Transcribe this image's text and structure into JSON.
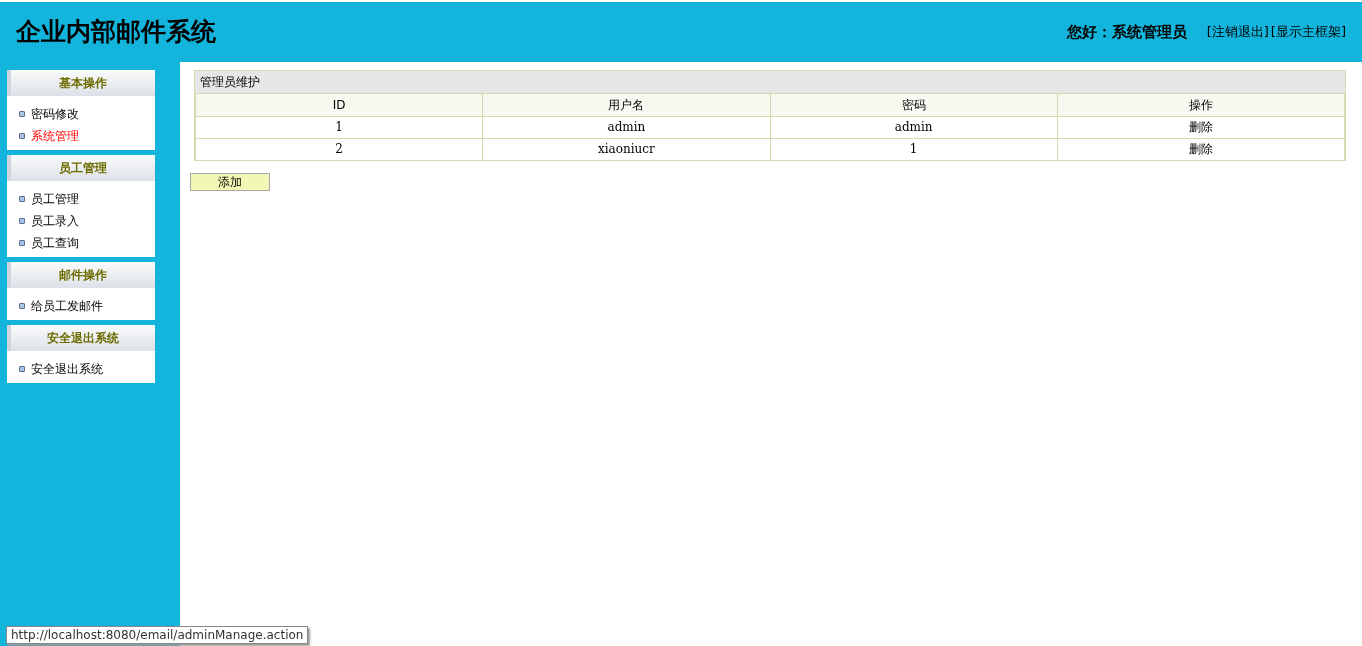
{
  "header": {
    "title": "企业内部邮件系统",
    "greeting": "您好：系统管理员",
    "links": [
      "[注销退出]",
      "[显示主框架]"
    ]
  },
  "sidebar": {
    "groups": [
      {
        "title": "基本操作",
        "items": [
          {
            "label": "密码修改",
            "selected": false
          },
          {
            "label": "系统管理",
            "selected": true
          }
        ]
      },
      {
        "title": "员工管理",
        "items": [
          {
            "label": "员工管理",
            "selected": false
          },
          {
            "label": "员工录入",
            "selected": false
          },
          {
            "label": "员工查询",
            "selected": false
          }
        ]
      },
      {
        "title": "邮件操作",
        "items": [
          {
            "label": "给员工发邮件",
            "selected": false
          }
        ]
      },
      {
        "title": "安全退出系统",
        "items": [
          {
            "label": "安全退出系统",
            "selected": false
          }
        ]
      }
    ]
  },
  "table": {
    "caption": "管理员维护",
    "columns": [
      "ID",
      "用户名",
      "密码",
      "操作"
    ],
    "rows": [
      [
        "1",
        "admin",
        "admin",
        "删除"
      ],
      [
        "2",
        "xiaoniucr",
        "1",
        "删除"
      ]
    ]
  },
  "add_button": "添加",
  "status_url": "http://localhost:8080/email/adminManage.action"
}
